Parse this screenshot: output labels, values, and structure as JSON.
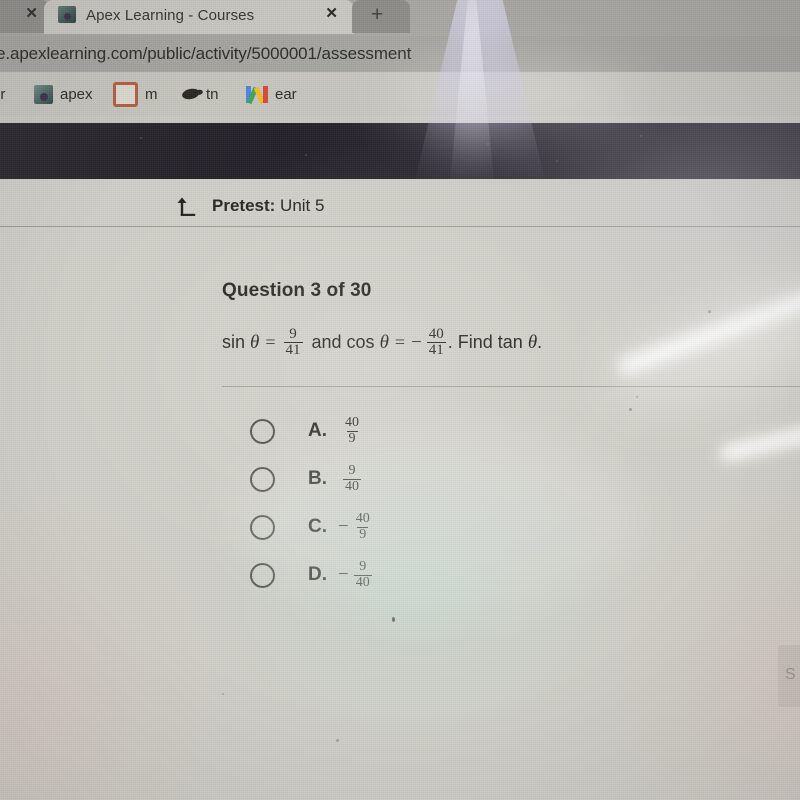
{
  "browser": {
    "tabs": [
      {
        "title": "",
        "close_label": "✕",
        "active": false,
        "partial": true
      },
      {
        "title": "Apex Learning - Courses",
        "close_label": "✕",
        "active": true,
        "partial": false
      }
    ],
    "new_tab_label": "+",
    "url": "e.apexlearning.com/public/activity/5000001/assessment",
    "bookmarks": [
      {
        "label": "or",
        "icon": "none"
      },
      {
        "label": "apex",
        "icon": "apex-icon"
      },
      {
        "label": "m",
        "icon": "orange-square-icon"
      },
      {
        "label": "tn",
        "icon": "dark-blob-icon"
      },
      {
        "label": "ear",
        "icon": "gmail-icon"
      }
    ]
  },
  "page": {
    "header": {
      "return_icon": "return-arrow-icon",
      "title_bold": "Pretest:",
      "title_rest": "Unit 5"
    },
    "question": {
      "number_label": "Question 3 of 30",
      "prefix_sin": "sin",
      "theta": "θ",
      "eq1": "=",
      "fraction1": {
        "num": "9",
        "den": "41"
      },
      "connector": "and cos",
      "eq2": "=",
      "minus": "−",
      "fraction2": {
        "num": "40",
        "den": "41"
      },
      "suffix": ". Find tan",
      "end_theta": "θ",
      "period": "."
    },
    "options": [
      {
        "letter": "A.",
        "negative": "",
        "num": "40",
        "den": "9",
        "selected": false
      },
      {
        "letter": "B.",
        "negative": "",
        "num": "9",
        "den": "40",
        "selected": false
      },
      {
        "letter": "C.",
        "negative": "−",
        "num": "40",
        "den": "9",
        "selected": false
      },
      {
        "letter": "D.",
        "negative": "−",
        "num": "9",
        "den": "40",
        "selected": false
      }
    ],
    "submit_partial_label": "S"
  },
  "colors": {
    "chrome_tabstrip": "#a9a8a2",
    "chrome_urlbar": "#a6a59f",
    "chrome_bookmarkbar": "#c6c5bd",
    "site_navbar": "#2b2730",
    "page_background": "#cfcec6",
    "text_primary": "#1e1f1b",
    "bookmark_orange": "#c05a3a"
  }
}
